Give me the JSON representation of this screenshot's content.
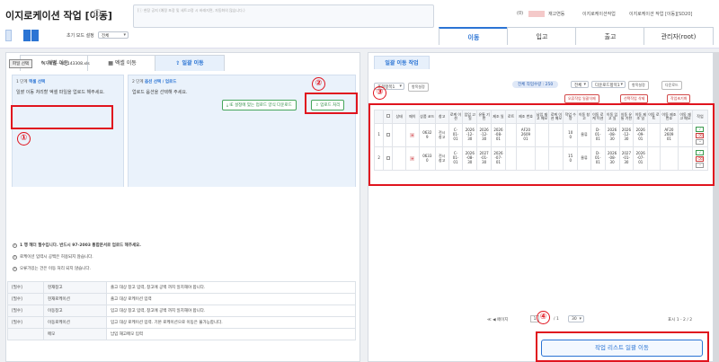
{
  "header": {
    "title": "이지로케이션 작업 [이동]",
    "memo_placeholder": "[ⓘ 현장 공지 (예정 포장 및 세트고정 시 바래지면, 자동화의 많습니다.)",
    "breadcrumb": [
      "(0)",
      "재고연동",
      "이지로케이션작업",
      "이지로케이션 작업 [이동][SD20]"
    ],
    "init_mode_label": "초기 모드 설정",
    "init_mode_value": "전체"
  },
  "main_tabs": [
    "이동",
    "입고",
    "출고",
    "관리자(root)"
  ],
  "left": {
    "sub_tabs": [
      "개별 이동",
      "엑셀 이동",
      "일괄 이동"
    ],
    "step1": {
      "title_prefix": "1 단계",
      "title_strong": "엑셀 선택",
      "desc": "일괄 이동 처리할 엑셀 파일을 업로드 해주세요.",
      "file_button": "파일 선택",
      "file_name": "이지로케···30_143308.xls"
    },
    "step2": {
      "title_prefix": "2 단계",
      "title_strong": "옵션 선택 / 업로드",
      "desc": "업로드 옵션을 선택해 주세요.",
      "sample_button": "IE 설정에 맞는 업로드 양식 다운로드",
      "upload_button": "업로드 처리"
    },
    "notices": [
      "1 행 헤더 필수입니다. 반드시 97-2003 통합문서로 업로드 해주세요.",
      "로케이션 입력시 공백은 허용되지 않습니다.",
      "오류가있는 건은 이동 처리 되지 않습니다."
    ],
    "requirements": [
      {
        "tag": "[필수]",
        "name": "현재창고",
        "desc": "출고 대상 창고 입력, 창고에 공백 까지 일치해야 합니다."
      },
      {
        "tag": "[필수]",
        "name": "현재로케이션",
        "desc": "출고 대상 로케이션 입력"
      },
      {
        "tag": "[필수]",
        "name": "이동창고",
        "desc": "입고 대상 창고 입력, 창고에 공백 까지 일치해야 합니다."
      },
      {
        "tag": "[필수]",
        "name": "이동로케이션",
        "desc": "입고 대상 로케이션 입력. 기본 로케이션으로 이동은 불가능합니다."
      },
      {
        "tag": "",
        "name": "메모",
        "desc": "납입 재고메모 입력"
      }
    ]
  },
  "right": {
    "tab": "일괄 이동 작업",
    "toolbar": {
      "select1": "조회항목1",
      "btn_set": "항목설정",
      "pill": "전체 작업수량 : 250",
      "select2": "전체",
      "select3": "다운로드항목1",
      "btn_item": "항목설정",
      "btn_down": "다운로드",
      "btn_del_err": "오류작업 일괄삭제",
      "btn_del_sel": "선택작업 삭제",
      "btn_reset": "작업초기화"
    },
    "columns": [
      "상태",
      "메이",
      "상품\n코드",
      "창고",
      "로케\n이션",
      "입입\n고일",
      "유통\n기한",
      "제조\n일",
      "로트",
      "제조\n번호",
      "납입\n재고\n메모",
      "로케\n이션\n메모",
      "작업\n수량",
      "이동\n창고",
      "이동\n로케\n이션",
      "이동\n입고\n일",
      "이동\n유통\n기한",
      "이동\n제조\n일",
      "이동\n로트",
      "이동\n제조\n번호",
      "이동\n재고\n메모",
      "작업"
    ],
    "rows": [
      {
        "no": "1",
        "code": "0632\n9",
        "wh": "전시\n창고",
        "loc": "C-\n01-\n01",
        "in": "2026\n-12-\n30",
        "exp": "2026\n-12-\n30",
        "mfg": "2026\n-08-\n01",
        "mfgno": "AF20\n2609\n01",
        "qty": "10\n0",
        "mwh": "물류",
        "mloc": "D-\n01-\n01",
        "min": "2026\n-08-\n30",
        "mexp": "2026\n-12-\n30",
        "mmfg": "2026\n-09-\n01",
        "mmfgno": "AF20\n2609\n01"
      },
      {
        "no": "2",
        "code": "0633\n0",
        "wh": "전시\n창고",
        "loc": "C-\n01-\n01",
        "in": "2026\n-08-\n30",
        "exp": "2027\n-01-\n30",
        "mfg": "2026\n-07-\n01",
        "mfgno": "",
        "qty": "15\n0",
        "mwh": "물류",
        "mloc": "D-\n01-\n01",
        "min": "2026\n-08-\n30",
        "mexp": "2027\n-01-\n30",
        "mmfg": "2026\n-07-\n01",
        "mmfgno": ""
      }
    ],
    "pager": {
      "prev": "≪  ◀ 페이지",
      "page": "1",
      "of": "/ 1",
      "size": "30",
      "total": "표시 1 - 2 / 2"
    },
    "move_button": "작업 리스트 일괄 이동"
  },
  "annotations": [
    "①",
    "②",
    "③",
    "④"
  ],
  "colors": {
    "accent": "#2b74d4",
    "marker": "#e0141e"
  }
}
